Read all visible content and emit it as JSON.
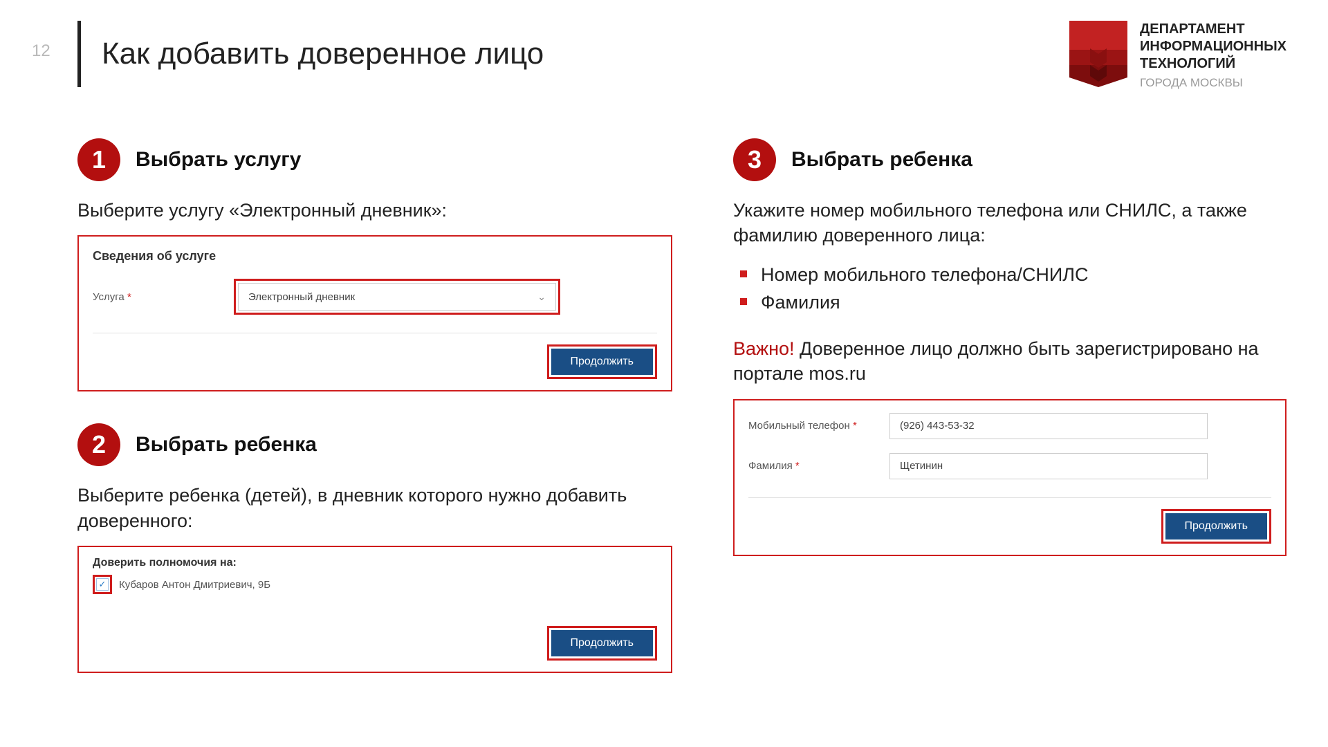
{
  "page_number": "12",
  "title": "Как добавить доверенное лицо",
  "logo": {
    "l1": "ДЕПАРТАМЕНТ",
    "l2": "ИНФОРМАЦИОННЫХ",
    "l3": "ТЕХНОЛОГИЙ",
    "sub": "ГОРОДА МОСКВЫ"
  },
  "step1": {
    "num": "1",
    "title": "Выбрать услугу",
    "desc": "Выберите услугу «Электронный дневник»:",
    "box_title": "Сведения об услуге",
    "field_label": "Услуга",
    "select_value": "Электронный дневник",
    "button": "Продолжить"
  },
  "step2": {
    "num": "2",
    "title": "Выбрать ребенка",
    "desc": "Выберите ребенка (детей), в дневник которого нужно добавить доверенного:",
    "box_title": "Доверить полномочия на:",
    "child": "Кубаров Антон Дмитриевич, 9Б",
    "button": "Продолжить"
  },
  "step3": {
    "num": "3",
    "title": "Выбрать ребенка",
    "desc_main": "Укажите номер мобильного телефона или СНИЛС, а также фамилию доверенного лица:",
    "bullet1": "Номер мобильного телефона/СНИЛС",
    "bullet2": "Фамилия",
    "warn_label": "Важно!",
    "warn_text": " Доверенное лицо должно быть зарегистрировано на портале mos.ru",
    "phone_label": "Мобильный телефон",
    "phone_value": "(926) 443-53-32",
    "surname_label": "Фамилия",
    "surname_value": "Щетинин",
    "button": "Продолжить"
  }
}
